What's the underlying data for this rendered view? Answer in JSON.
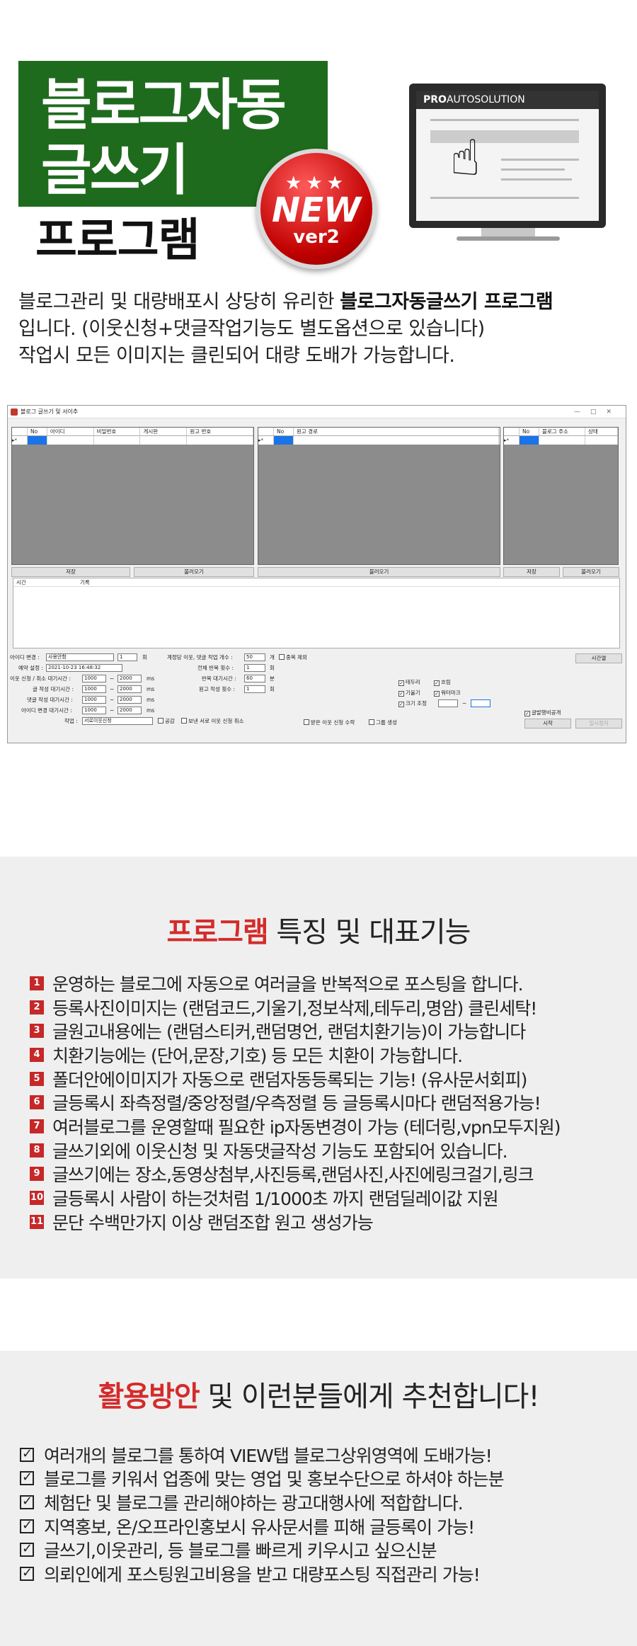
{
  "hero": {
    "title_line1": "블로그자동",
    "title_line2": "글쓰기",
    "title_line3": "프로그램",
    "badge_stars": "★★★",
    "badge_new": "NEW",
    "badge_ver": "ver2",
    "monitor_brand_bold": "PRO",
    "monitor_brand_rest": "AUTOSOLUTION",
    "intro_line1_prefix": "블로그관리 및 대량배포시 상당히 유리한 ",
    "intro_line1_bold": "블로그자동글쓰기 프로그램",
    "intro_line2": "입니다. (이웃신청+댓글작업기능도 별도옵션으로 있습니다)",
    "intro_line3": "작업시 모든 이미지는 클린되어 대량 도배가 가능합니다."
  },
  "app": {
    "window_title": "블로그 글쓰기 및 서이추",
    "window_controls": "—□✕",
    "grid1_headers": [
      "No",
      "아이디",
      "비밀번호",
      "게시판",
      "원고 번호"
    ],
    "grid2_headers": [
      "No",
      "원고 경로"
    ],
    "grid3_headers": [
      "No",
      "블로그 주소",
      "상태"
    ],
    "row_marker": "▸*",
    "btn_save1": "저장",
    "btn_load1": "불러오기",
    "btn_load2": "불러오기",
    "btn_save3": "저장",
    "btn_load3": "불러오기",
    "log_headers": [
      "시간",
      "기록"
    ],
    "id_change_label": "아이디 변경 :",
    "id_change_value": "사용안함",
    "id_change_count": "1",
    "id_change_unit": "회",
    "reserve_label": "예약 설정 :",
    "reserve_value": "2021-10-23 16:48:32",
    "neighbor_wait_label": "이웃 신청 / 취소 대기시간 :",
    "post_wait_label": "글 작성 대기시간 :",
    "comment_wait_label": "댓글 작성 대기시간 :",
    "idchange_wait_label": "아이디 변경 대기시간 :",
    "wait_min": "1000",
    "wait_max": "2000",
    "wait_sep": "~",
    "wait_unit": "ms",
    "task_label": "작업 :",
    "task_value": "서로이웃신청",
    "per_account_label": "계정당 이웃, 댓글 작업 개수 :",
    "per_account_value": "50",
    "per_account_unit": "개",
    "dup_exclude": "중복 제외",
    "total_repeat_label": "전체 반복 횟수 :",
    "total_repeat_value": "1",
    "total_repeat_unit": "회",
    "repeat_wait_label": "반복 대기시간 :",
    "repeat_wait_value": "60",
    "repeat_wait_unit": "분",
    "doc_count_label": "원고 작성 횟수 :",
    "doc_count_value": "1",
    "doc_count_unit": "회",
    "opt_border": "테두리",
    "opt_blur": "흐림",
    "opt_tilt": "기울기",
    "opt_watermark": "워터마크",
    "opt_resize": "크기 조정",
    "resize_sep": "~",
    "opt_public": "공감",
    "opt_cancel_sent": "보낸 서로 이웃 신청 취소",
    "opt_accept_received": "받은 이웃 신청 수락",
    "opt_group_create": "그룹 생성",
    "opt_post_public": "글발행비공개",
    "btn_time": "시간열",
    "btn_start": "시작",
    "btn_stop": "일시정지"
  },
  "features": {
    "title_bold": "프로그램",
    "title_rest": " 특징 및 대표기능",
    "items": [
      {
        "n": "1",
        "text": "운영하는 블로그에 자동으로 여러글을 반복적으로 포스팅을 합니다."
      },
      {
        "n": "2",
        "text": "등록사진이미지는 (랜덤코드,기울기,정보삭제,테두리,명암) 클린세탁!"
      },
      {
        "n": "3",
        "text": "글원고내용에는 (랜덤스티커,랜덤명언, 랜덤치환기능)이 가능합니다"
      },
      {
        "n": "4",
        "text": "치환기능에는 (단어,문장,기호) 등 모든 치환이 가능합니다."
      },
      {
        "n": "5",
        "text": "폴더안에이미지가 자동으로 랜덤자동등록되는 기능! (유사문서회피)"
      },
      {
        "n": "6",
        "text": "글등록시 좌측정렬/중앙정렬/우측정렬 등 글등록시마다 랜덤적용가능!"
      },
      {
        "n": "7",
        "text": "여러블로그를 운영할때 필요한 ip자동변경이 가능 (테더링,vpn모두지원)"
      },
      {
        "n": "8",
        "text": "글쓰기외에 이웃신청 및 자동댓글작성 기능도 포함되어 있습니다."
      },
      {
        "n": "9",
        "text": "글쓰기에는 장소,동영상첨부,사진등록,랜덤사진,사진에링크걸기,링크"
      },
      {
        "n": "10",
        "text": "글등록시 사람이 하는것처럼 1/1000초 까지 랜덤딜레이값 지원"
      },
      {
        "n": "11",
        "text": "문단 수백만가지 이상 랜덤조합 원고 생성가능"
      }
    ]
  },
  "usage": {
    "title_bold": "활용방안",
    "title_rest": " 및 이런분들에게 추천합니다!",
    "items": [
      "여러개의 블로그를 통하여 VIEW탭 블로그상위영역에 도배가능!",
      "블로그를 키워서 업종에 맞는 영업 및 홍보수단으로 하셔야 하는분",
      "체험단 및 블로그를 관리해야하는 광고대행사에 적합합니다.",
      "지역홍보, 온/오프라인홍보시 유사문서를 피해 글등록이 가능!",
      "글쓰기,이웃관리, 등 블로그를 빠르게 키우시고 싶으신분",
      "의뢰인에게 포스팅원고비용을 받고 대량포스팅 직접관리 가능!"
    ],
    "check_mark": "✓"
  },
  "colors": {
    "title_bg": "#1f6b1e",
    "accent_red": "#d42b2b",
    "section_bg": "#efefef"
  }
}
